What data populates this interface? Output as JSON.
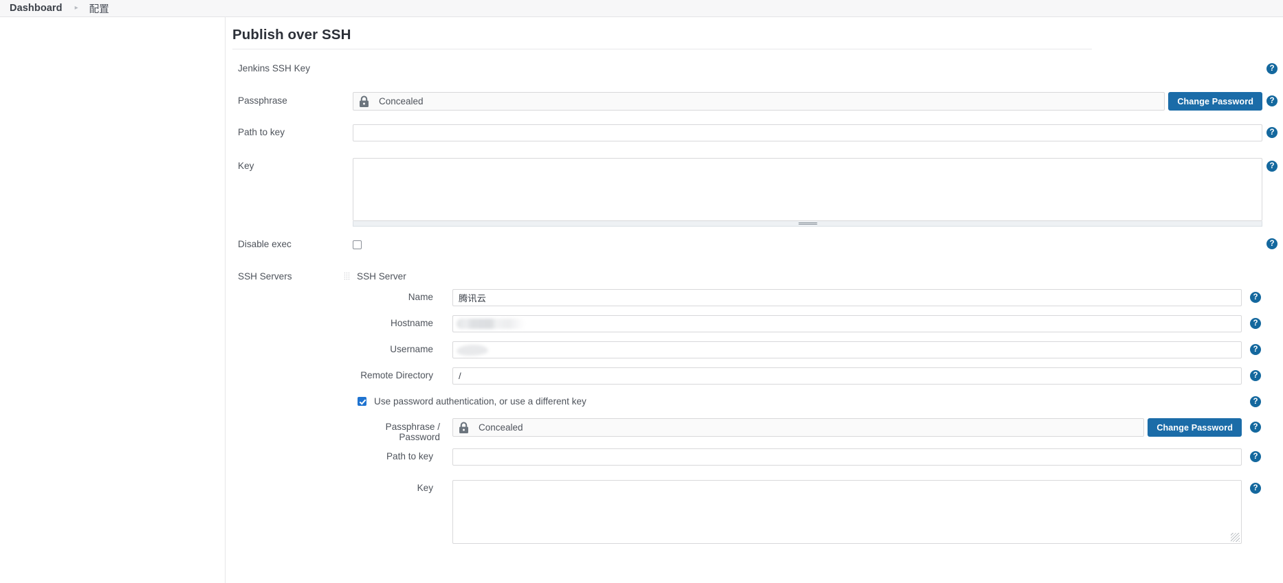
{
  "breadcrumb": {
    "home": "Dashboard",
    "separator": "▸",
    "current": "配置"
  },
  "section": {
    "title": "Publish over SSH"
  },
  "help_icon_glyph": "?",
  "colors": {
    "button_blue": "#1b6ca8",
    "help_blue": "#14689e",
    "checkbox_blue": "#1f73d0",
    "header_bg": "#f7f7f8",
    "lock_gray": "#6c757e"
  },
  "jenkins_key": {
    "label": "Jenkins SSH Key",
    "passphrase": {
      "label": "Passphrase",
      "value": "Concealed",
      "lock_icon": "lock-icon",
      "change_button": "Change Password"
    },
    "path_to_key": {
      "label": "Path to key",
      "value": "",
      "placeholder": ""
    },
    "key": {
      "label": "Key",
      "value": "",
      "placeholder": ""
    }
  },
  "disable_exec": {
    "label": "Disable exec",
    "checked": false
  },
  "ssh_servers": {
    "label": "SSH Servers",
    "server_title": "SSH Server",
    "drag_handle_icon": "drag-grip-icon",
    "fields": {
      "name": {
        "label": "Name",
        "value": "腾讯云"
      },
      "hostname": {
        "label": "Hostname",
        "value": "",
        "redacted": true
      },
      "username": {
        "label": "Username",
        "value": "",
        "redacted": true
      },
      "remote_directory": {
        "label": "Remote Directory",
        "value": "/"
      }
    },
    "use_password_auth": {
      "label": "Use password authentication, or use a different key",
      "checked": true
    },
    "passphrase_password": {
      "label": "Passphrase / Password",
      "value": "Concealed",
      "lock_icon": "lock-icon",
      "change_button": "Change Password"
    },
    "path_to_key": {
      "label": "Path to key",
      "value": ""
    },
    "key": {
      "label": "Key",
      "value": ""
    }
  }
}
